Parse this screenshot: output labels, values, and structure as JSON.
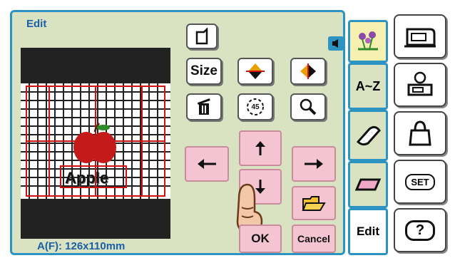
{
  "header": {
    "title": "Edit"
  },
  "preview": {
    "size_text": "A(F): 126x110mm",
    "motif_text": "Apple"
  },
  "buttons": {
    "size_label": "Size",
    "ok_label": "OK",
    "cancel_label": "Cancel",
    "rotate_label": "45"
  },
  "tabs": {
    "az_label": "A~Z",
    "edit_label": "Edit"
  },
  "side_buttons": {
    "set_label": "SET",
    "help_label": "?"
  },
  "colors": {
    "accent": "#2d93c2",
    "panel": "#d9e3c1",
    "pink_button": "#f4c4d2",
    "title_blue": "#1a5fa8"
  }
}
